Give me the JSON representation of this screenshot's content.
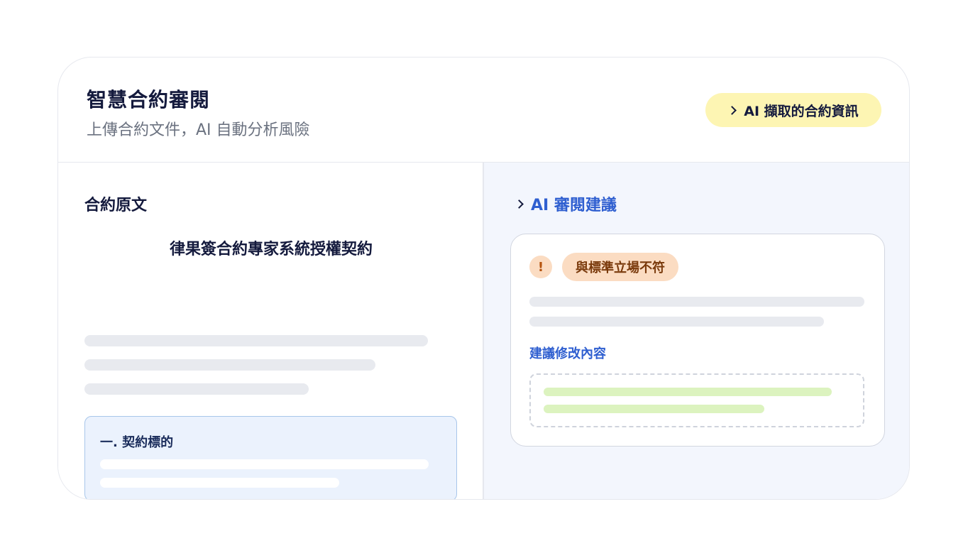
{
  "header": {
    "title": "智慧合約審閱",
    "subtitle": "上傳合約文件，AI 自動分析風險",
    "extract_button_label": "AI 擷取的合約資訊",
    "extract_button_icon": "chevron-right-icon"
  },
  "left_pane": {
    "section_title": "合約原文",
    "document_title": "律果簽合約專家系統授權契約",
    "clause": {
      "title": "一. 契約標的"
    }
  },
  "right_pane": {
    "section_title": "AI 審閱建議",
    "section_icon": "chevron-right-icon",
    "suggestion": {
      "warning_icon_glyph": "!",
      "warning_label": "與標準立場不符",
      "revise_label": "建議修改內容"
    }
  },
  "colors": {
    "accent_blue": "#2f5fd0",
    "badge_yellow": "#fdf5b3",
    "warning_orange": "#fbdcc2",
    "clause_highlight": "#ebf2fd",
    "revision_green": "#dcf3bf"
  }
}
